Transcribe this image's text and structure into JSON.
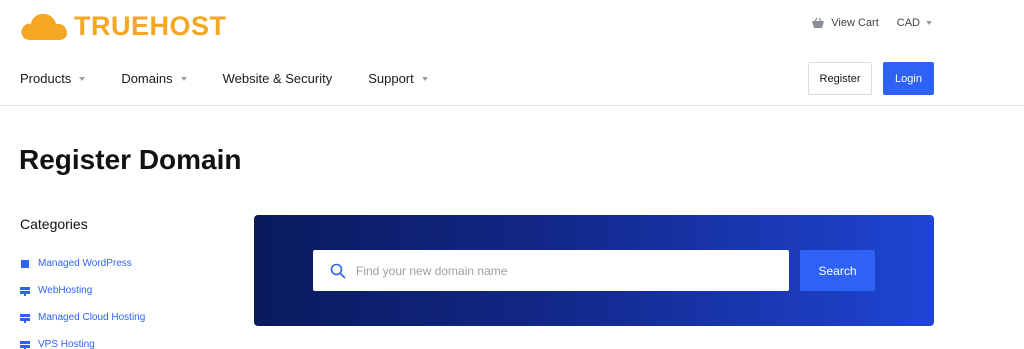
{
  "brand": {
    "name": "TRUEHOST",
    "color": "#f5a623"
  },
  "topbar": {
    "cart_label": "View Cart",
    "currency": "CAD",
    "cart_icon": "basket-icon"
  },
  "nav": {
    "items": [
      {
        "label": "Products",
        "has_dropdown": true
      },
      {
        "label": "Domains",
        "has_dropdown": true
      },
      {
        "label": "Website & Security",
        "has_dropdown": false
      },
      {
        "label": "Support",
        "has_dropdown": true
      }
    ]
  },
  "auth": {
    "register_label": "Register",
    "login_label": "Login"
  },
  "page": {
    "title": "Register Domain"
  },
  "sidebar": {
    "title": "Categories",
    "items": [
      {
        "label": "Managed WordPress",
        "icon": "box-icon"
      },
      {
        "label": "WebHosting",
        "icon": "server-icon"
      },
      {
        "label": "Managed Cloud Hosting",
        "icon": "server-icon"
      },
      {
        "label": "VPS Hosting",
        "icon": "server-icon"
      }
    ]
  },
  "search": {
    "placeholder": "Find your new domain name",
    "value": "",
    "button_label": "Search"
  },
  "colors": {
    "accent": "#2e62f5",
    "hero_gradient_start": "#0a1a5c",
    "hero_gradient_end": "#1f45d4"
  }
}
